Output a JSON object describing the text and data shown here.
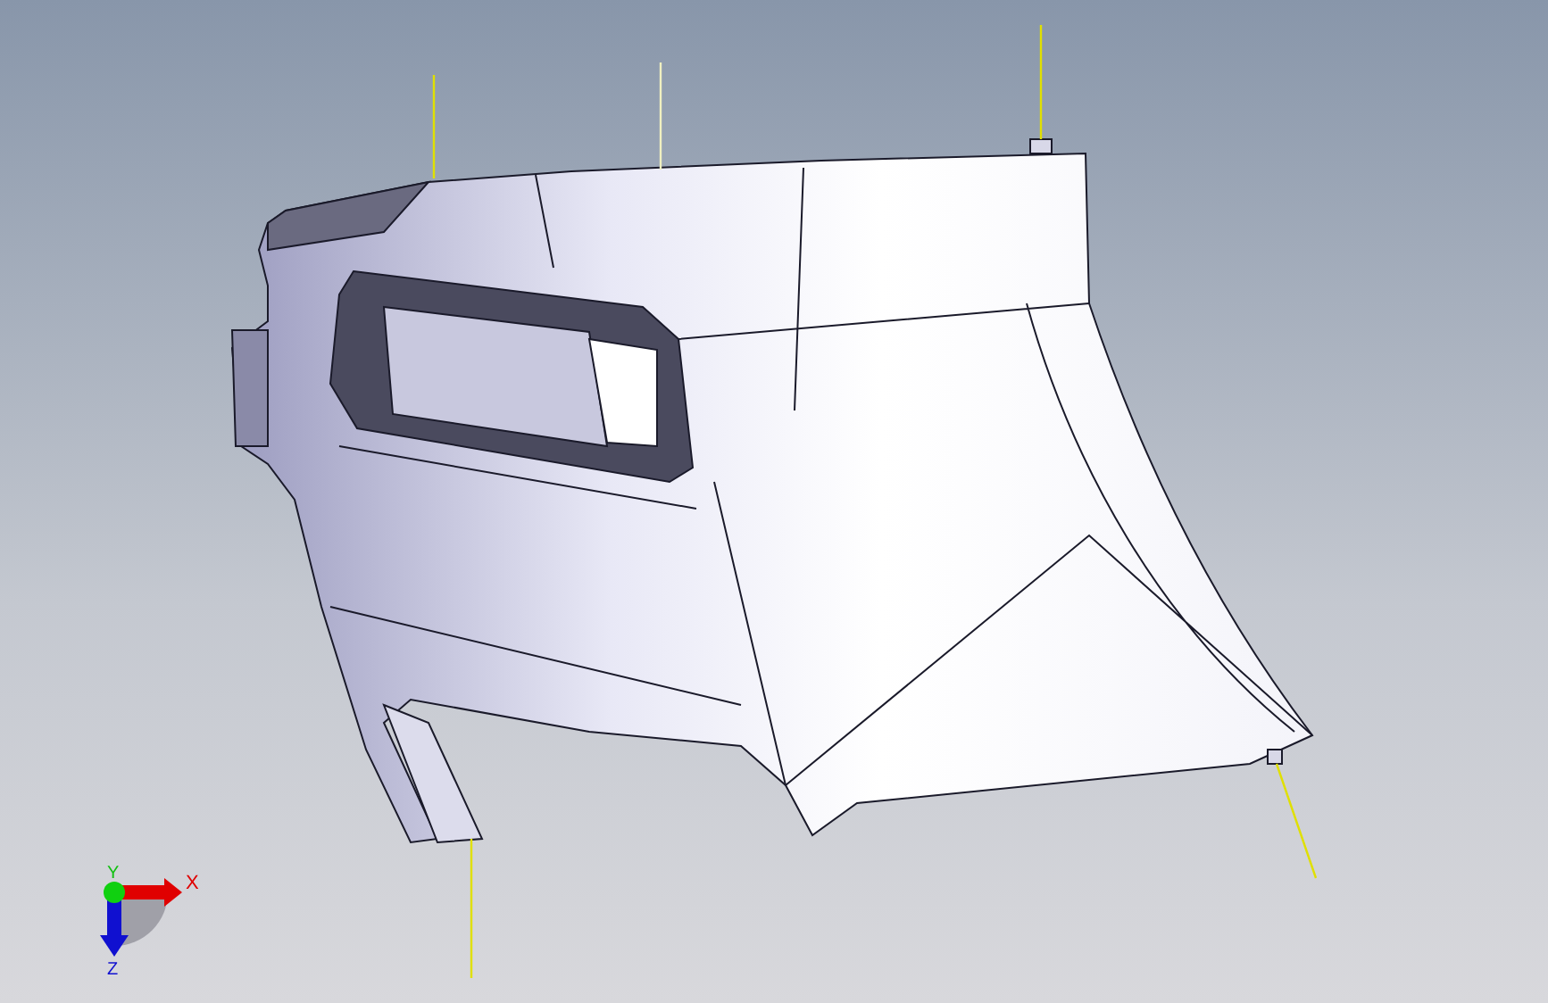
{
  "viewport": {
    "axis_triad": {
      "x_label": "X",
      "y_label": "Y",
      "z_label": "Z"
    }
  }
}
